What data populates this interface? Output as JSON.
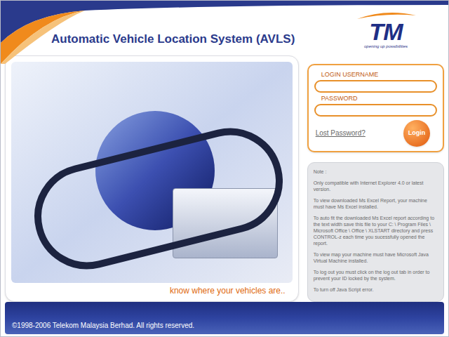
{
  "header": {
    "title": "Automatic Vehicle Location System (AVLS)"
  },
  "logo": {
    "mark": "TM",
    "tagline": "opening up possibilities"
  },
  "banner": {
    "caption": "know where your vehicles are.."
  },
  "login": {
    "fields": [
      {
        "label": "LOGIN USERNAME",
        "kind": "text"
      },
      {
        "label": "PASSWORD",
        "kind": "password"
      }
    ],
    "lost_password": "Lost Password?",
    "button": "Login"
  },
  "note": {
    "title": "Note :",
    "lines": [
      "Only compatible with Internet Explorer 4.0 or latest version.",
      "To view downloaded Ms Excel Report, your machine must have Ms Excel installed.",
      "To auto fit the downloaded Ms Excel report according to the text width save this file to your C: \\ Program Files \\ Microsoft Office \\ Office \\ XLSTART directory and press CONTROL-z each time you sucessfully opened the report.",
      "To view map your machine must have Microsoft Java Virtual Machine installed.",
      "To log out you must click on the log out tab in order to prevent your ID locked by the system.",
      "To turn off Java Script error."
    ]
  },
  "footer": "©1998-2006 Telekom Malaysia Berhad. All rights reserved."
}
